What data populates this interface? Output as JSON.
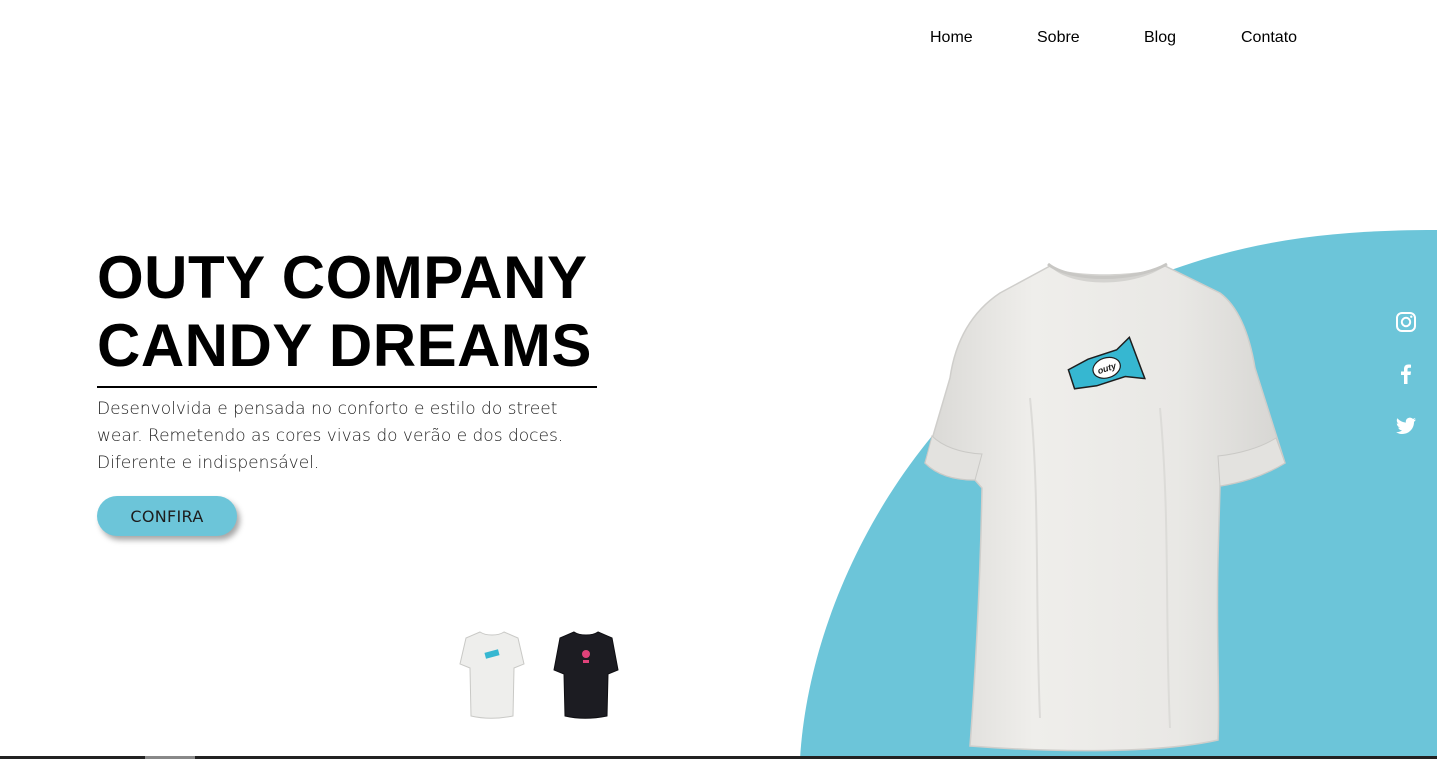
{
  "nav": {
    "items": [
      {
        "label": "Home"
      },
      {
        "label": "Sobre"
      },
      {
        "label": "Blog"
      },
      {
        "label": "Contato"
      }
    ]
  },
  "hero": {
    "title_line1": "OUTY COMPANY",
    "title_line2": "CANDY DREAMS",
    "description": "Desenvolvida e pensada no conforto e estilo do street wear. Remetendo as cores vivas do verão e dos doces. Diferente e indispensável.",
    "cta_label": "CONFIRA"
  },
  "shirt_logo_text": "outy",
  "thumbnails": [
    {
      "name": "white-tshirt-thumbnail",
      "color": "#f2f2f0"
    },
    {
      "name": "black-tshirt-thumbnail",
      "color": "#1c1c22"
    }
  ],
  "social": [
    "instagram-icon",
    "facebook-icon",
    "twitter-icon"
  ],
  "colors": {
    "accent": "#6cc5d9",
    "text": "#000000",
    "shirt_white": "#ecebe8",
    "candy_pink": "#e0427a"
  }
}
